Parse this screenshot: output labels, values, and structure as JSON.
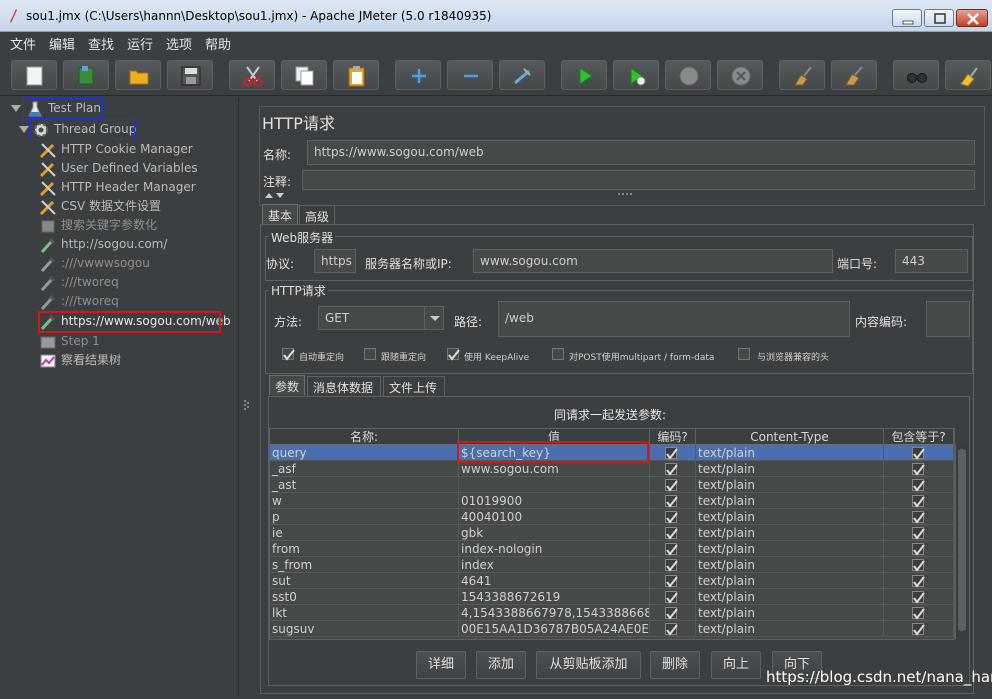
{
  "window": {
    "title": "sou1.jmx (C:\\Users\\hannn\\Desktop\\sou1.jmx) - Apache JMeter (5.0 r1840935)"
  },
  "menu": [
    "文件",
    "编辑",
    "查找",
    "运行",
    "选项",
    "帮助"
  ],
  "tree": {
    "items": [
      {
        "label": "Test Plan"
      },
      {
        "label": "Thread Group"
      },
      {
        "label": "HTTP Cookie Manager"
      },
      {
        "label": "User Defined Variables"
      },
      {
        "label": "HTTP Header Manager"
      },
      {
        "label": "CSV 数据文件设置"
      },
      {
        "label": "搜索关键字参数化"
      },
      {
        "label": "http://sogou.com/"
      },
      {
        "label": ":///vwwwsogou"
      },
      {
        "label": ":///tworeq"
      },
      {
        "label": ":///tworeq"
      },
      {
        "label": "https://www.sogou.com/web"
      },
      {
        "label": "Step 1"
      },
      {
        "label": "察看结果树"
      }
    ]
  },
  "panel": {
    "title": "HTTP请求",
    "name_label": "名称:",
    "name_value": "https://www.sogou.com/web",
    "comment_label": "注释:",
    "tabs": [
      "基本",
      "高级"
    ],
    "web_server": {
      "group_title": "Web服务器",
      "protocol_label": "协议:",
      "protocol_value": "https",
      "server_label": "服务器名称或IP:",
      "server_value": "www.sogou.com",
      "port_label": "端口号:",
      "port_value": "443"
    },
    "http_request": {
      "group_title": "HTTP请求",
      "method_label": "方法:",
      "method_value": "GET",
      "path_label": "路径:",
      "path_value": "/web",
      "encoding_label": "内容编码:"
    },
    "options": [
      {
        "label": "自动重定向",
        "checked": true
      },
      {
        "label": "跟随重定向",
        "checked": false
      },
      {
        "label": "使用 KeepAlive",
        "checked": true
      },
      {
        "label": "对POST使用multipart / form-data",
        "checked": false
      },
      {
        "label": "与浏览器兼容的头",
        "checked": false
      }
    ],
    "sub_tabs": [
      "参数",
      "消息体数据",
      "文件上传"
    ],
    "params_header": "同请求一起发送参数:",
    "columns": [
      "名称:",
      "值",
      "编码?",
      "Content-Type",
      "包含等于?"
    ],
    "rows": [
      {
        "name": "query",
        "value": "${search_key}",
        "type": "text/plain"
      },
      {
        "name": "_asf",
        "value": "www.sogou.com",
        "type": "text/plain"
      },
      {
        "name": "_ast",
        "value": "",
        "type": "text/plain"
      },
      {
        "name": "w",
        "value": "01019900",
        "type": "text/plain"
      },
      {
        "name": "p",
        "value": "40040100",
        "type": "text/plain"
      },
      {
        "name": "ie",
        "value": "gbk",
        "type": "text/plain"
      },
      {
        "name": "from",
        "value": "index-nologin",
        "type": "text/plain"
      },
      {
        "name": "s_from",
        "value": "index",
        "type": "text/plain"
      },
      {
        "name": "sut",
        "value": "4641",
        "type": "text/plain"
      },
      {
        "name": "sst0",
        "value": "1543388672619",
        "type": "text/plain"
      },
      {
        "name": "lkt",
        "value": "4,1543388667978,1543388668...",
        "type": "text/plain"
      },
      {
        "name": "sugsuv",
        "value": "00E15AA1D36787B05A24AE0E...",
        "type": "text/plain"
      }
    ],
    "buttons": [
      "详细",
      "添加",
      "从剪贴板添加",
      "删除",
      "向上",
      "向下"
    ]
  },
  "watermark": "https://blog.csdn.net/nana_han"
}
